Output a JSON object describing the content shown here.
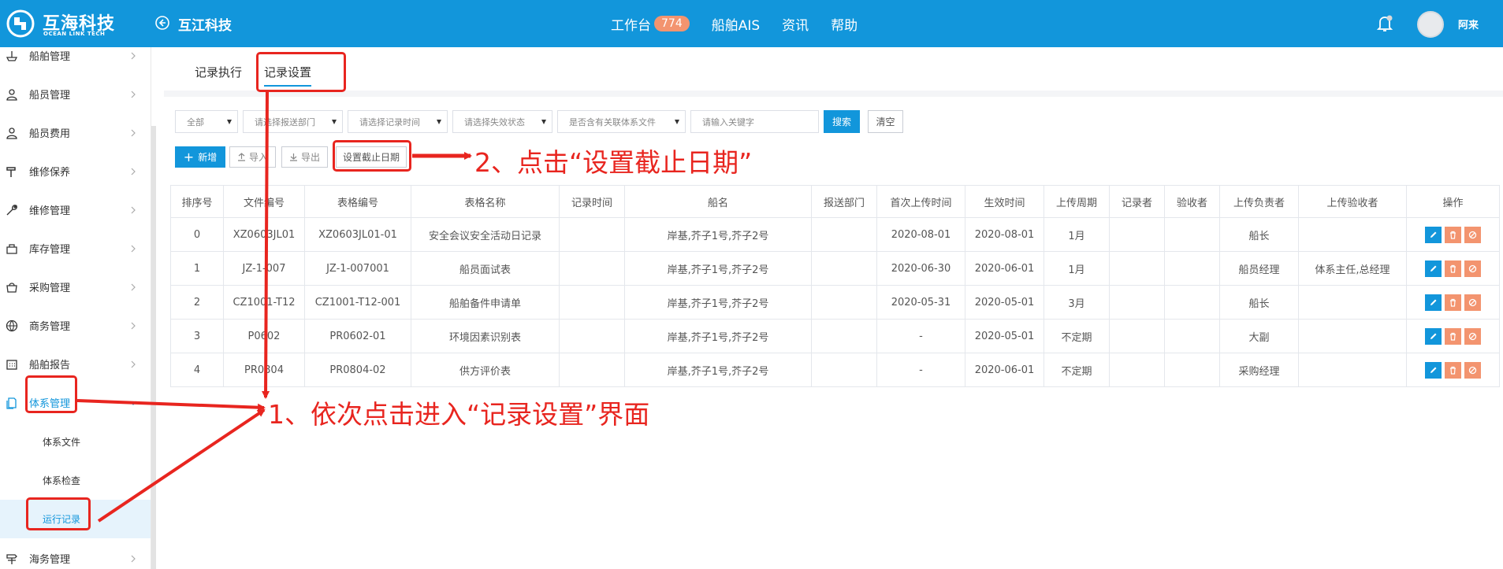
{
  "header": {
    "logo_cn": "互海科技",
    "logo_en": "OCEAN LINK TECH",
    "company": "互江科技",
    "nav": [
      {
        "label": "工作台",
        "badge": "774"
      },
      {
        "label": "船舶AIS"
      },
      {
        "label": "资讯"
      },
      {
        "label": "帮助"
      }
    ],
    "user": "阿来",
    "brand_color": "#1296db"
  },
  "sidebar": {
    "items": [
      {
        "label": "船舶管理",
        "icon": "ship-icon"
      },
      {
        "label": "船员管理",
        "icon": "user-icon"
      },
      {
        "label": "船员费用",
        "icon": "user-money-icon"
      },
      {
        "label": "维修保养",
        "icon": "hammer-icon"
      },
      {
        "label": "维修管理",
        "icon": "wrench-icon"
      },
      {
        "label": "库存管理",
        "icon": "box-icon"
      },
      {
        "label": "采购管理",
        "icon": "bag-icon"
      },
      {
        "label": "商务管理",
        "icon": "globe-icon"
      },
      {
        "label": "船舶报告",
        "icon": "calendar-icon"
      },
      {
        "label": "体系管理",
        "icon": "document-icon"
      },
      {
        "label": "海务管理",
        "icon": "signpost-icon"
      }
    ],
    "sub_items": [
      "体系文件",
      "体系检查",
      "运行记录"
    ]
  },
  "tabs": [
    "记录执行",
    "记录设置"
  ],
  "filters": {
    "scope": "全部",
    "department": "请选择报送部门",
    "record_time": "请选择记录时间",
    "status": "请选择失效状态",
    "linked": "是否含有关联体系文件",
    "keyword_placeholder": "请输入关键字",
    "search": "搜索",
    "clear": "清空"
  },
  "actions": {
    "add": "新增",
    "import": "导入",
    "export": "导出",
    "deadline": "设置截止日期"
  },
  "table": {
    "headers": [
      "排序号",
      "文件编号",
      "表格编号",
      "表格名称",
      "记录时间",
      "船名",
      "报送部门",
      "首次上传时间",
      "生效时间",
      "上传周期",
      "记录者",
      "验收者",
      "上传负责者",
      "上传验收者",
      "操作"
    ],
    "rows": [
      [
        "0",
        "XZ0603JL01",
        "XZ0603JL01-01",
        "安全会议安全活动日记录",
        "",
        "岸基,芥子1号,芥子2号",
        "",
        "2020-08-01",
        "2020-08-01",
        "1月",
        "",
        "",
        "船长",
        ""
      ],
      [
        "1",
        "JZ-1-007",
        "JZ-1-007001",
        "船员面试表",
        "",
        "岸基,芥子1号,芥子2号",
        "",
        "2020-06-30",
        "2020-06-01",
        "1月",
        "",
        "",
        "船员经理",
        "体系主任,总经理"
      ],
      [
        "2",
        "CZ1001-T12",
        "CZ1001-T12-001",
        "船舶备件申请单",
        "",
        "岸基,芥子1号,芥子2号",
        "",
        "2020-05-31",
        "2020-05-01",
        "3月",
        "",
        "",
        "船长",
        ""
      ],
      [
        "3",
        "P0602",
        "PR0602-01",
        "环境因素识别表",
        "",
        "岸基,芥子1号,芥子2号",
        "",
        "-",
        "2020-05-01",
        "不定期",
        "",
        "",
        "大副",
        ""
      ],
      [
        "4",
        "PR0804",
        "PR0804-02",
        "供方评价表",
        "",
        "岸基,芥子1号,芥子2号",
        "",
        "-",
        "2020-06-01",
        "不定期",
        "",
        "",
        "采购经理",
        ""
      ]
    ]
  },
  "annotations": {
    "step1": "1、依次点击进入“记录设置”界面",
    "step2": "2、点击“设置截止日期”",
    "color": "#e8251f"
  }
}
